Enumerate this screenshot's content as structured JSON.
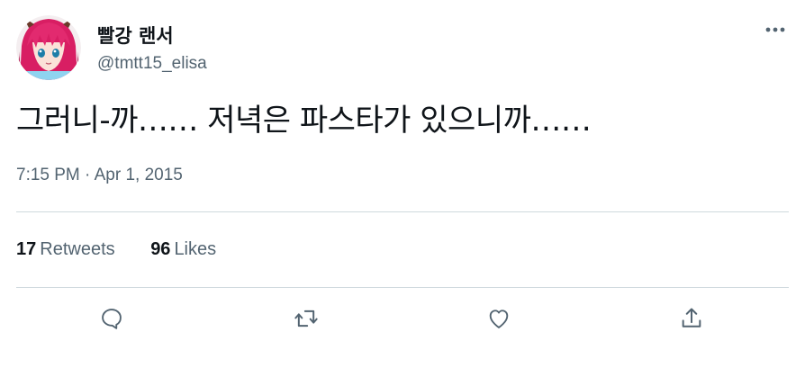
{
  "tweet": {
    "display_name": "빨강 랜서",
    "handle": "@tmtt15_elisa",
    "avatar_icon": "profile-avatar-anime-pink-hair",
    "text": "그러니-까…… 저녁은 파스타가 있으니까……",
    "time": "7:15 PM",
    "separator": "·",
    "date": "Apr 1, 2015",
    "retweets_count": "17",
    "retweets_label": "Retweets",
    "likes_count": "96",
    "likes_label": "Likes"
  },
  "icons": {
    "more": "more-horizontal-icon",
    "reply": "reply-icon",
    "retweet": "retweet-icon",
    "like": "heart-icon",
    "share": "share-icon"
  },
  "colors": {
    "text_primary": "#0f1419",
    "text_secondary": "#536471",
    "divider": "#cfd9de"
  }
}
